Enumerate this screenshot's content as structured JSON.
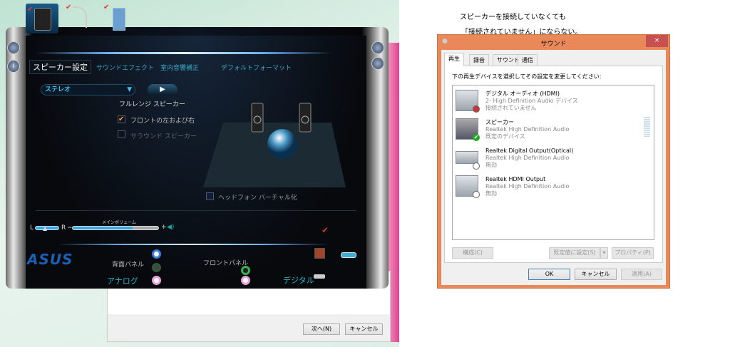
{
  "caption": {
    "line1": "スピーカーを接続していなくても",
    "line2": "「接続されていません」にならない。"
  },
  "asus": {
    "tabs": [
      "スピーカー設定",
      "サウンドエフェクト",
      "室内音響補正",
      "デフォルトフォーマット"
    ],
    "config_select": "ステレオ",
    "play_label": "▶",
    "fullrange_label": "フルレンジ スピーカー",
    "front_lr": "フロントの左および右",
    "surround": "サラウンド スピーカー",
    "headphone": "ヘッドフォン バーチャル化",
    "balance_l": "L",
    "balance_r": "R",
    "main_volume": "メインボリューム",
    "minus": "−",
    "plus": "+",
    "volume_percent": 70,
    "logo": "ASUS",
    "rear_panel": "背面パネル",
    "front_panel": "フロントパネル",
    "analog": "アナログ",
    "digital": "デジタル"
  },
  "back_dialog": {
    "next": "次へ(N)",
    "cancel": "キャンセル"
  },
  "sound_dialog": {
    "title": "サウンド",
    "close": "×",
    "tabs": [
      "再生",
      "録音",
      "サウンド",
      "通信"
    ],
    "instruction": "下の再生デバイスを選択してその設定を変更してください:",
    "devices": [
      {
        "name": "デジタル オーディオ (HDMI)",
        "driver": "2- High Definition Audio デバイス",
        "status": "接続されていません"
      },
      {
        "name": "スピーカー",
        "driver": "Realtek High Definition Audio",
        "status": "既定のデバイス"
      },
      {
        "name": "Realtek Digital Output(Optical)",
        "driver": "Realtek High Definition Audio",
        "status": "無効"
      },
      {
        "name": "Realtek HDMI Output",
        "driver": "Realtek High Definition Audio",
        "status": "無効"
      }
    ],
    "configure": "構成(C)",
    "set_default": "既定値に設定(S)",
    "properties": "プロパティ(P)",
    "ok": "OK",
    "cancel": "キャンセル",
    "apply": "適用(A)"
  },
  "colors": {
    "accent": "#3ba7c7",
    "window_border": "#e9895a",
    "close": "#c75050"
  }
}
